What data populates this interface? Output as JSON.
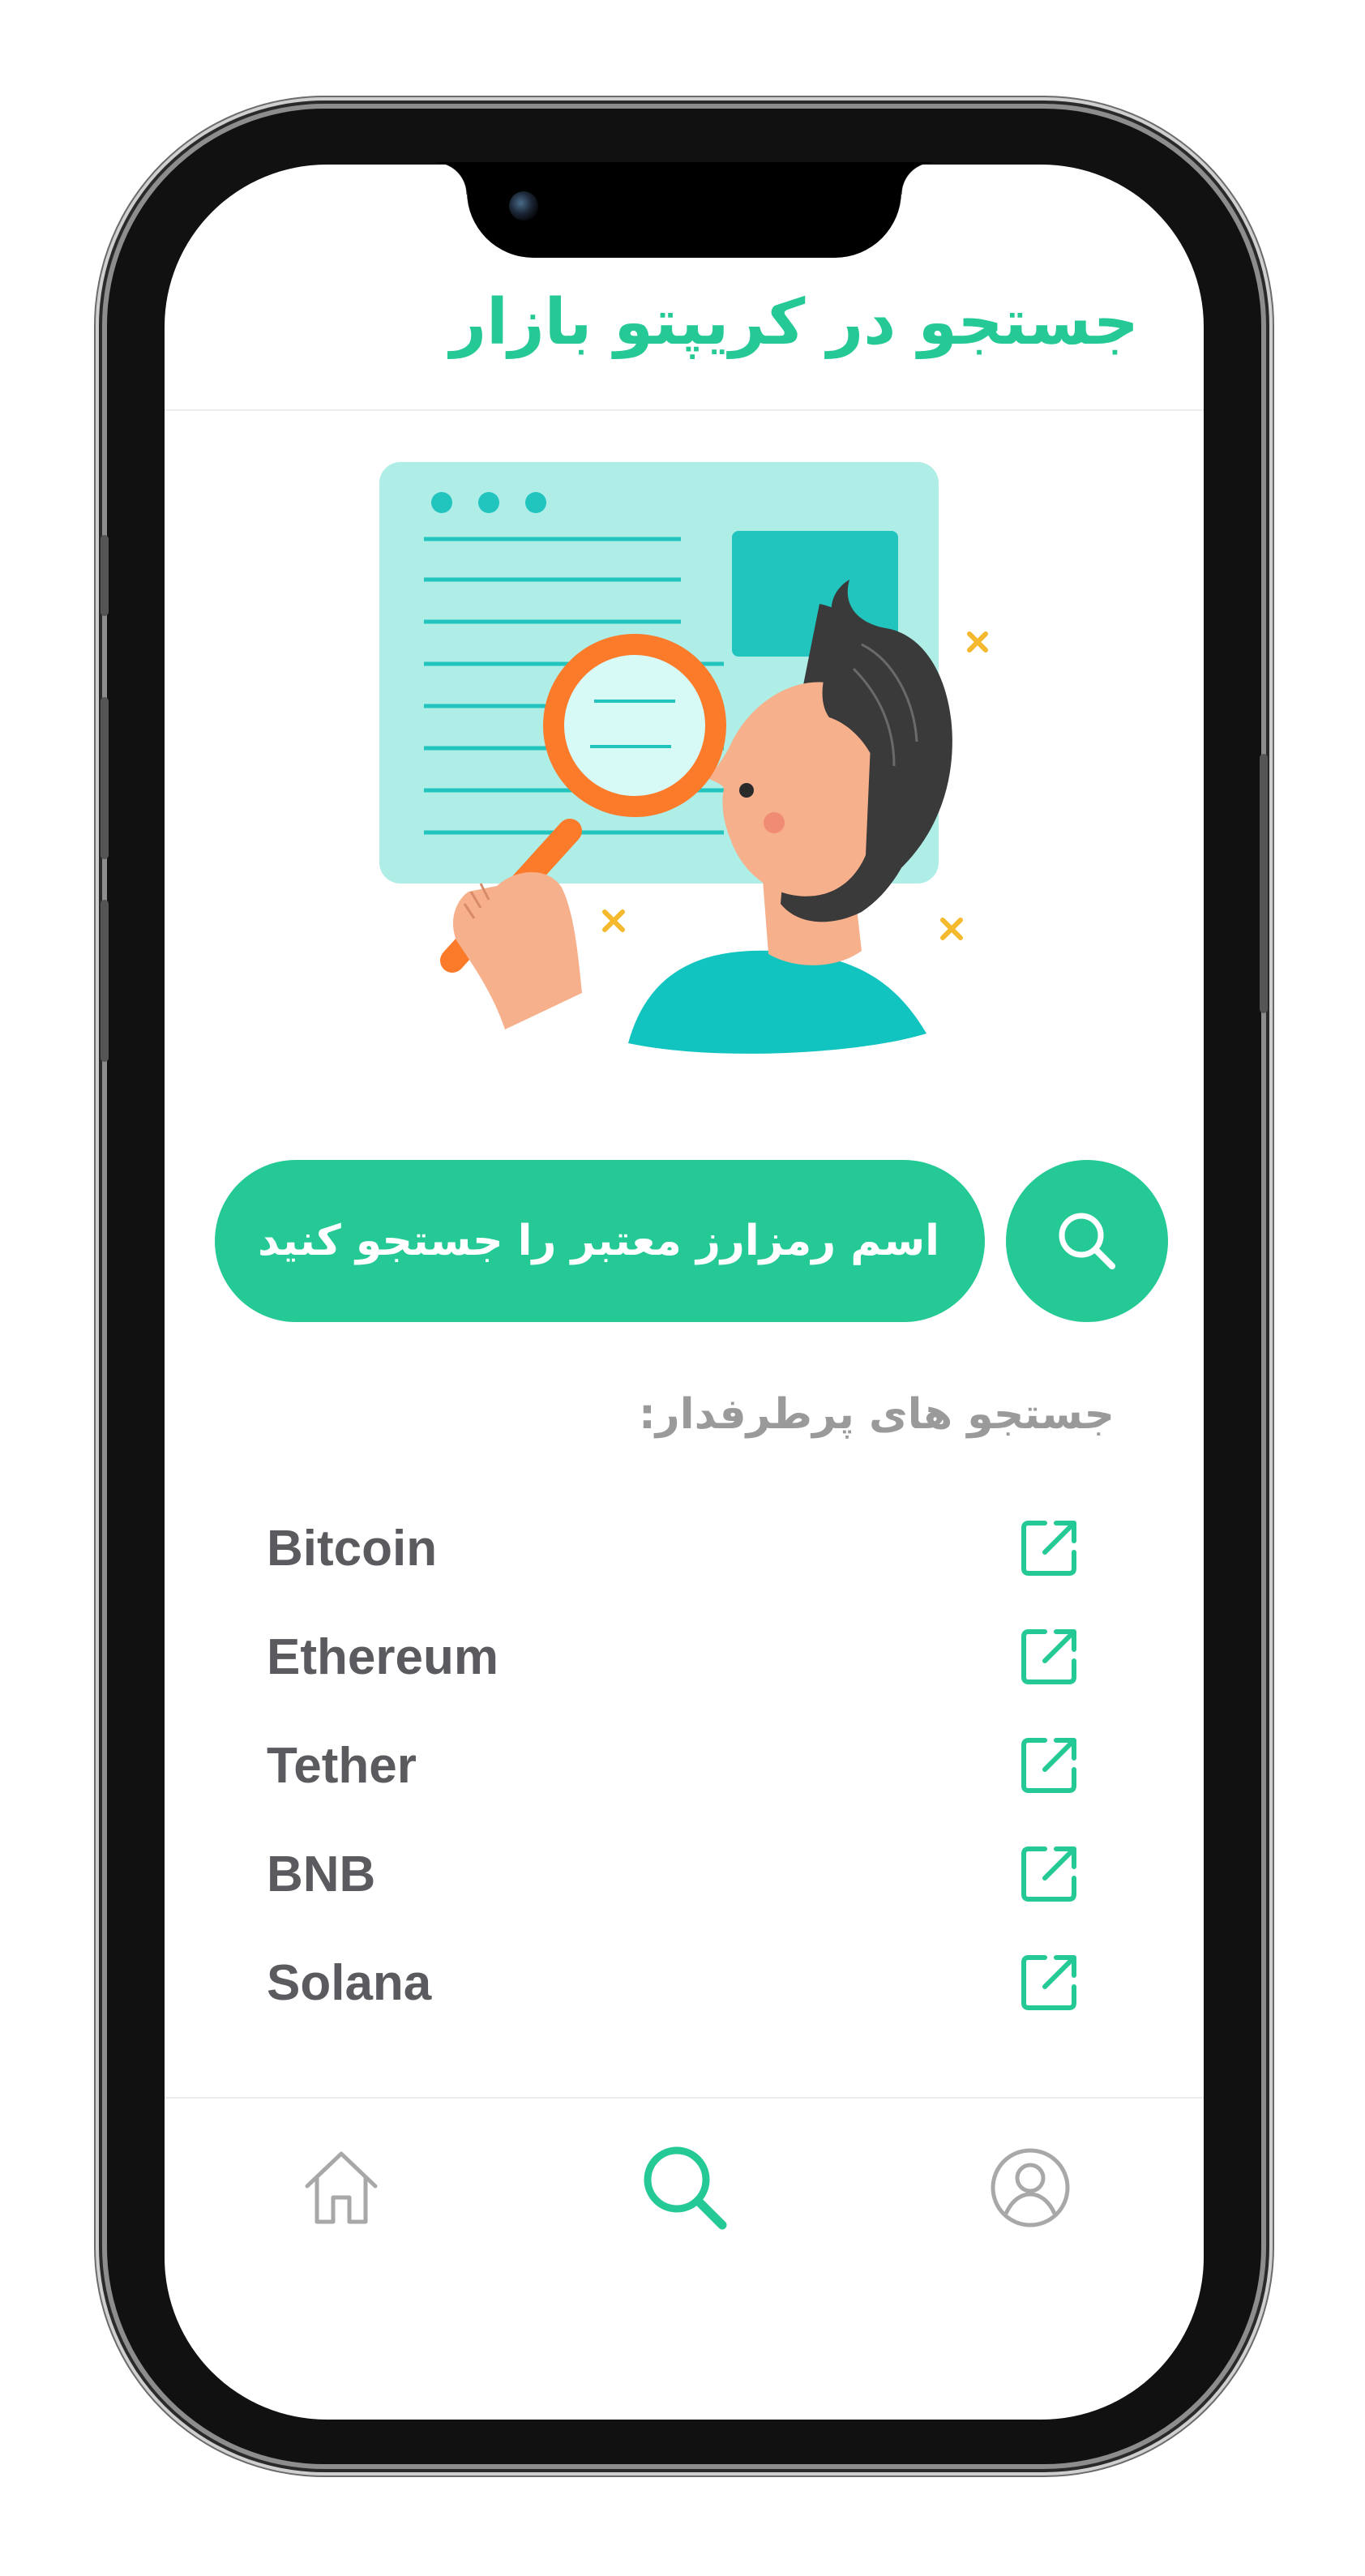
{
  "app": {
    "title": "جستجو در کریپتو بازار"
  },
  "search": {
    "placeholder": "اسم رمزارز معتبر را جستجو کنید...",
    "button_icon": "search-icon"
  },
  "popular": {
    "title": "جستجو های پرطرفدار:",
    "items": [
      {
        "label": "Bitcoin",
        "icon": "external-link-icon"
      },
      {
        "label": "Ethereum",
        "icon": "external-link-icon"
      },
      {
        "label": "Tether",
        "icon": "external-link-icon"
      },
      {
        "label": "BNB",
        "icon": "external-link-icon"
      },
      {
        "label": "Solana",
        "icon": "external-link-icon"
      }
    ]
  },
  "nav": {
    "items": [
      {
        "icon": "home-icon",
        "active": false
      },
      {
        "icon": "search-icon",
        "active": true
      },
      {
        "icon": "user-icon",
        "active": false
      }
    ]
  },
  "colors": {
    "accent": "#24c996",
    "text_dark": "#5a5a5f",
    "text_muted": "#9a9a9a",
    "nav_inactive": "#a8a8a8"
  }
}
